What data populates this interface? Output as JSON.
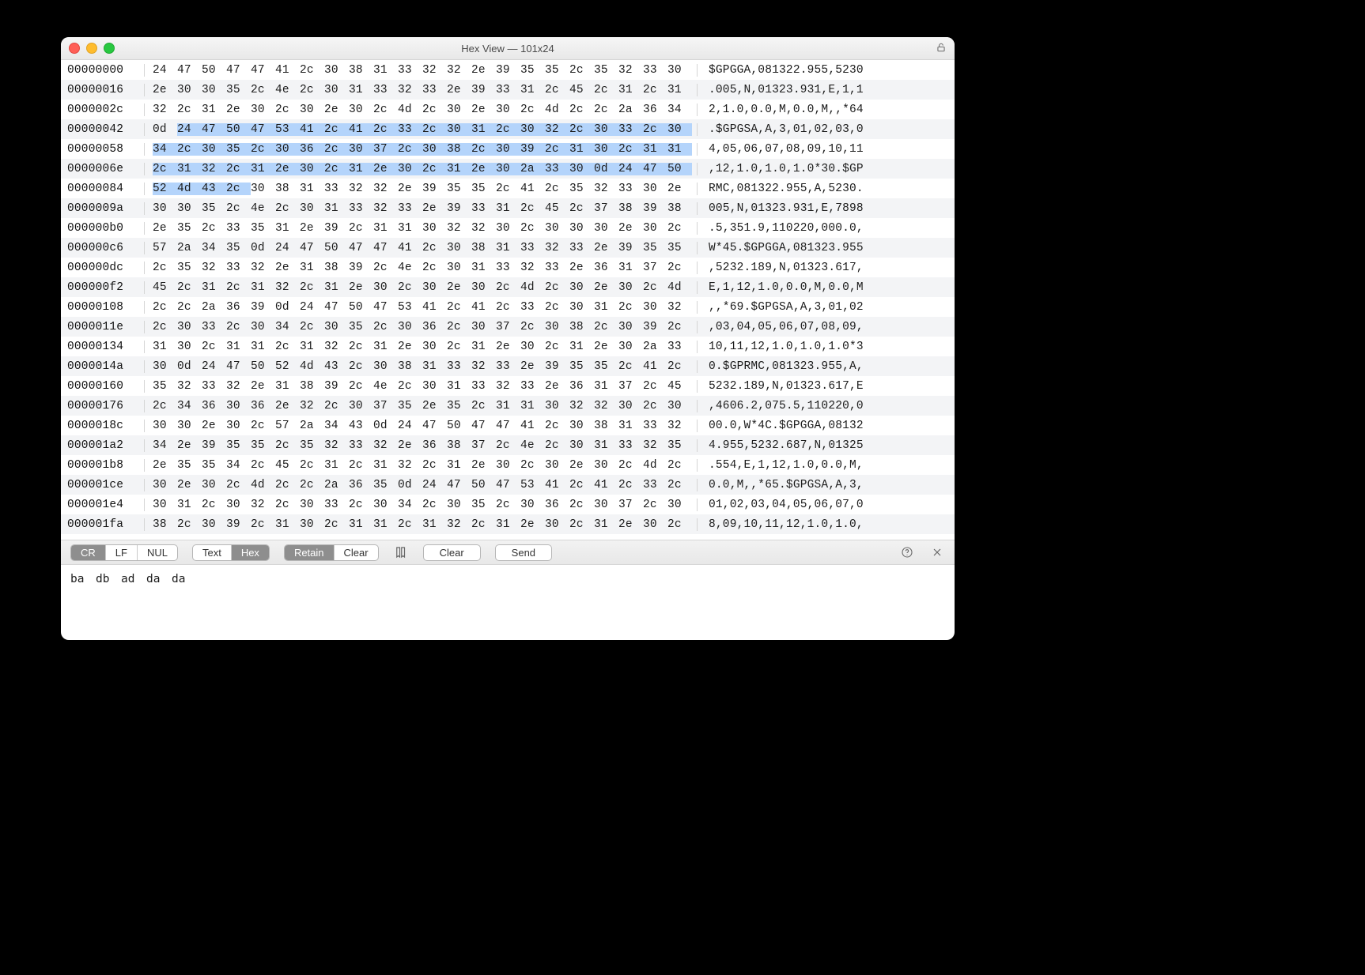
{
  "window": {
    "title": "Hex View — 101x24"
  },
  "bytes_per_row": 22,
  "selection": {
    "start": 67,
    "end": 135
  },
  "rows": [
    {
      "offset": "00000000",
      "hex": [
        "24",
        "47",
        "50",
        "47",
        "47",
        "41",
        "2c",
        "30",
        "38",
        "31",
        "33",
        "32",
        "32",
        "2e",
        "39",
        "35",
        "35",
        "2c",
        "35",
        "32",
        "33",
        "30"
      ],
      "ascii": "$GPGGA,081322.955,5230"
    },
    {
      "offset": "00000016",
      "hex": [
        "2e",
        "30",
        "30",
        "35",
        "2c",
        "4e",
        "2c",
        "30",
        "31",
        "33",
        "32",
        "33",
        "2e",
        "39",
        "33",
        "31",
        "2c",
        "45",
        "2c",
        "31",
        "2c",
        "31"
      ],
      "ascii": ".005,N,01323.931,E,1,1"
    },
    {
      "offset": "0000002c",
      "hex": [
        "32",
        "2c",
        "31",
        "2e",
        "30",
        "2c",
        "30",
        "2e",
        "30",
        "2c",
        "4d",
        "2c",
        "30",
        "2e",
        "30",
        "2c",
        "4d",
        "2c",
        "2c",
        "2a",
        "36",
        "34"
      ],
      "ascii": "2,1.0,0.0,M,0.0,M,,*64"
    },
    {
      "offset": "00000042",
      "hex": [
        "0d",
        "24",
        "47",
        "50",
        "47",
        "53",
        "41",
        "2c",
        "41",
        "2c",
        "33",
        "2c",
        "30",
        "31",
        "2c",
        "30",
        "32",
        "2c",
        "30",
        "33",
        "2c",
        "30"
      ],
      "ascii": ".$GPGSA,A,3,01,02,03,0"
    },
    {
      "offset": "00000058",
      "hex": [
        "34",
        "2c",
        "30",
        "35",
        "2c",
        "30",
        "36",
        "2c",
        "30",
        "37",
        "2c",
        "30",
        "38",
        "2c",
        "30",
        "39",
        "2c",
        "31",
        "30",
        "2c",
        "31",
        "31"
      ],
      "ascii": "4,05,06,07,08,09,10,11"
    },
    {
      "offset": "0000006e",
      "hex": [
        "2c",
        "31",
        "32",
        "2c",
        "31",
        "2e",
        "30",
        "2c",
        "31",
        "2e",
        "30",
        "2c",
        "31",
        "2e",
        "30",
        "2a",
        "33",
        "30",
        "0d",
        "24",
        "47",
        "50"
      ],
      "ascii": ",12,1.0,1.0,1.0*30.$GP"
    },
    {
      "offset": "00000084",
      "hex": [
        "52",
        "4d",
        "43",
        "2c",
        "30",
        "38",
        "31",
        "33",
        "32",
        "32",
        "2e",
        "39",
        "35",
        "35",
        "2c",
        "41",
        "2c",
        "35",
        "32",
        "33",
        "30",
        "2e"
      ],
      "ascii": "RMC,081322.955,A,5230."
    },
    {
      "offset": "0000009a",
      "hex": [
        "30",
        "30",
        "35",
        "2c",
        "4e",
        "2c",
        "30",
        "31",
        "33",
        "32",
        "33",
        "2e",
        "39",
        "33",
        "31",
        "2c",
        "45",
        "2c",
        "37",
        "38",
        "39",
        "38"
      ],
      "ascii": "005,N,01323.931,E,7898"
    },
    {
      "offset": "000000b0",
      "hex": [
        "2e",
        "35",
        "2c",
        "33",
        "35",
        "31",
        "2e",
        "39",
        "2c",
        "31",
        "31",
        "30",
        "32",
        "32",
        "30",
        "2c",
        "30",
        "30",
        "30",
        "2e",
        "30",
        "2c"
      ],
      "ascii": ".5,351.9,110220,000.0,"
    },
    {
      "offset": "000000c6",
      "hex": [
        "57",
        "2a",
        "34",
        "35",
        "0d",
        "24",
        "47",
        "50",
        "47",
        "47",
        "41",
        "2c",
        "30",
        "38",
        "31",
        "33",
        "32",
        "33",
        "2e",
        "39",
        "35",
        "35"
      ],
      "ascii": "W*45.$GPGGA,081323.955"
    },
    {
      "offset": "000000dc",
      "hex": [
        "2c",
        "35",
        "32",
        "33",
        "32",
        "2e",
        "31",
        "38",
        "39",
        "2c",
        "4e",
        "2c",
        "30",
        "31",
        "33",
        "32",
        "33",
        "2e",
        "36",
        "31",
        "37",
        "2c"
      ],
      "ascii": ",5232.189,N,01323.617,"
    },
    {
      "offset": "000000f2",
      "hex": [
        "45",
        "2c",
        "31",
        "2c",
        "31",
        "32",
        "2c",
        "31",
        "2e",
        "30",
        "2c",
        "30",
        "2e",
        "30",
        "2c",
        "4d",
        "2c",
        "30",
        "2e",
        "30",
        "2c",
        "4d"
      ],
      "ascii": "E,1,12,1.0,0.0,M,0.0,M"
    },
    {
      "offset": "00000108",
      "hex": [
        "2c",
        "2c",
        "2a",
        "36",
        "39",
        "0d",
        "24",
        "47",
        "50",
        "47",
        "53",
        "41",
        "2c",
        "41",
        "2c",
        "33",
        "2c",
        "30",
        "31",
        "2c",
        "30",
        "32"
      ],
      "ascii": ",,*69.$GPGSA,A,3,01,02"
    },
    {
      "offset": "0000011e",
      "hex": [
        "2c",
        "30",
        "33",
        "2c",
        "30",
        "34",
        "2c",
        "30",
        "35",
        "2c",
        "30",
        "36",
        "2c",
        "30",
        "37",
        "2c",
        "30",
        "38",
        "2c",
        "30",
        "39",
        "2c"
      ],
      "ascii": ",03,04,05,06,07,08,09,"
    },
    {
      "offset": "00000134",
      "hex": [
        "31",
        "30",
        "2c",
        "31",
        "31",
        "2c",
        "31",
        "32",
        "2c",
        "31",
        "2e",
        "30",
        "2c",
        "31",
        "2e",
        "30",
        "2c",
        "31",
        "2e",
        "30",
        "2a",
        "33"
      ],
      "ascii": "10,11,12,1.0,1.0,1.0*3"
    },
    {
      "offset": "0000014a",
      "hex": [
        "30",
        "0d",
        "24",
        "47",
        "50",
        "52",
        "4d",
        "43",
        "2c",
        "30",
        "38",
        "31",
        "33",
        "32",
        "33",
        "2e",
        "39",
        "35",
        "35",
        "2c",
        "41",
        "2c"
      ],
      "ascii": "0.$GPRMC,081323.955,A,"
    },
    {
      "offset": "00000160",
      "hex": [
        "35",
        "32",
        "33",
        "32",
        "2e",
        "31",
        "38",
        "39",
        "2c",
        "4e",
        "2c",
        "30",
        "31",
        "33",
        "32",
        "33",
        "2e",
        "36",
        "31",
        "37",
        "2c",
        "45"
      ],
      "ascii": "5232.189,N,01323.617,E"
    },
    {
      "offset": "00000176",
      "hex": [
        "2c",
        "34",
        "36",
        "30",
        "36",
        "2e",
        "32",
        "2c",
        "30",
        "37",
        "35",
        "2e",
        "35",
        "2c",
        "31",
        "31",
        "30",
        "32",
        "32",
        "30",
        "2c",
        "30"
      ],
      "ascii": ",4606.2,075.5,110220,0"
    },
    {
      "offset": "0000018c",
      "hex": [
        "30",
        "30",
        "2e",
        "30",
        "2c",
        "57",
        "2a",
        "34",
        "43",
        "0d",
        "24",
        "47",
        "50",
        "47",
        "47",
        "41",
        "2c",
        "30",
        "38",
        "31",
        "33",
        "32"
      ],
      "ascii": "00.0,W*4C.$GPGGA,08132"
    },
    {
      "offset": "000001a2",
      "hex": [
        "34",
        "2e",
        "39",
        "35",
        "35",
        "2c",
        "35",
        "32",
        "33",
        "32",
        "2e",
        "36",
        "38",
        "37",
        "2c",
        "4e",
        "2c",
        "30",
        "31",
        "33",
        "32",
        "35"
      ],
      "ascii": "4.955,5232.687,N,01325"
    },
    {
      "offset": "000001b8",
      "hex": [
        "2e",
        "35",
        "35",
        "34",
        "2c",
        "45",
        "2c",
        "31",
        "2c",
        "31",
        "32",
        "2c",
        "31",
        "2e",
        "30",
        "2c",
        "30",
        "2e",
        "30",
        "2c",
        "4d",
        "2c"
      ],
      "ascii": ".554,E,1,12,1.0,0.0,M,"
    },
    {
      "offset": "000001ce",
      "hex": [
        "30",
        "2e",
        "30",
        "2c",
        "4d",
        "2c",
        "2c",
        "2a",
        "36",
        "35",
        "0d",
        "24",
        "47",
        "50",
        "47",
        "53",
        "41",
        "2c",
        "41",
        "2c",
        "33",
        "2c"
      ],
      "ascii": "0.0,M,,*65.$GPGSA,A,3,"
    },
    {
      "offset": "000001e4",
      "hex": [
        "30",
        "31",
        "2c",
        "30",
        "32",
        "2c",
        "30",
        "33",
        "2c",
        "30",
        "34",
        "2c",
        "30",
        "35",
        "2c",
        "30",
        "36",
        "2c",
        "30",
        "37",
        "2c",
        "30"
      ],
      "ascii": "01,02,03,04,05,06,07,0"
    },
    {
      "offset": "000001fa",
      "hex": [
        "38",
        "2c",
        "30",
        "39",
        "2c",
        "31",
        "30",
        "2c",
        "31",
        "31",
        "2c",
        "31",
        "32",
        "2c",
        "31",
        "2e",
        "30",
        "2c",
        "31",
        "2e",
        "30",
        "2c"
      ],
      "ascii": "8,09,10,11,12,1.0,1.0,"
    }
  ],
  "toolbar": {
    "line_ending": {
      "options": [
        "CR",
        "LF",
        "NUL"
      ],
      "selected": 0
    },
    "view_mode": {
      "options": [
        "Text",
        "Hex"
      ],
      "selected": 1
    },
    "keep_mode": {
      "options": [
        "Retain",
        "Clear"
      ],
      "selected": 0
    },
    "clear_label": "Clear",
    "send_label": "Send"
  },
  "input": {
    "bytes": [
      "ba",
      "db",
      "ad",
      "da",
      "da"
    ]
  }
}
